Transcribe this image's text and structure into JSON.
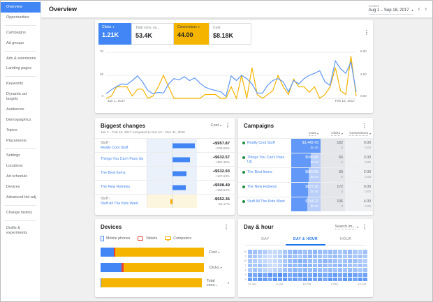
{
  "icons": {
    "kebab": "⋮",
    "caret": "▾",
    "chev_left": "‹",
    "chev_right": "›"
  },
  "colors": {
    "blue": "#4285f4",
    "yellow": "#f4b400",
    "red": "#ea4335",
    "green": "#1e8e3e",
    "heatmap_rgb": "66,133,244"
  },
  "sidebar": {
    "items": [
      {
        "label": "Overview",
        "selected": true
      },
      {
        "label": "Opportunities"
      },
      {
        "label": "Campaigns"
      },
      {
        "label": "Ad groups"
      },
      {
        "label": "Ads & extensions"
      },
      {
        "label": "Landing pages"
      },
      {
        "label": "Keywords"
      },
      {
        "label": "Dynamic ad targets"
      },
      {
        "label": "Audiences"
      },
      {
        "label": "Demographics"
      },
      {
        "label": "Topics"
      },
      {
        "label": "Placements"
      },
      {
        "label": "Settings"
      },
      {
        "label": "Locations"
      },
      {
        "label": "Ad schedule"
      },
      {
        "label": "Devices"
      },
      {
        "label": "Advanced bid adj."
      },
      {
        "label": "Change history"
      },
      {
        "label": "Drafts & experiments"
      }
    ]
  },
  "header": {
    "title": "Overview",
    "date_label": "Custom",
    "date_range": "Aug 1 – Sep 18, 2017"
  },
  "metrics": {
    "cards": [
      {
        "label": "Clicks",
        "value": "1.21K",
        "selected": true
      },
      {
        "label": "Total conv. va...",
        "value": "53.4K"
      },
      {
        "label": "Conversions",
        "value": "44.00",
        "selected": true
      },
      {
        "label": "Cost",
        "value": "$8.18K"
      }
    ]
  },
  "overview_chart": {
    "y_left": [
      "70",
      "35",
      "0"
    ],
    "y_right": [
      "6.00",
      "3.00",
      "0.00"
    ],
    "x_start": "Jan 1, 2017",
    "x_end": "Feb 18, 2017"
  },
  "biggest_changes": {
    "title": "Biggest changes",
    "subtitle": "Jan 1 – Feb 18, 2017 compared to Nov 13 – Dec 31, 2016",
    "metric_selector": "Cost",
    "rows": [
      {
        "prefix": "Stuff -",
        "name": "Really Cool Stuff",
        "change": "+$957.87",
        "percent": "+235.59%"
      },
      {
        "prefix": "",
        "name": "Things You Can't Pass Up",
        "change": "+$632.57",
        "percent": "+391.32%"
      },
      {
        "prefix": "",
        "name": "The Best Items",
        "change": "+$532.93",
        "percent": "+167.63%"
      },
      {
        "prefix": "",
        "name": "The New Hotness",
        "change": "+$508.49",
        "percent": "+159.52%"
      },
      {
        "prefix": "Stuff -",
        "name": "Stuff All The Kids Want",
        "change": "-$552.36",
        "percent": "-61.17%"
      }
    ]
  },
  "campaigns": {
    "title": "Campaigns",
    "columns": {
      "cost": "Cost",
      "clicks": "Clicks",
      "conversions": "Conversions"
    },
    "rows": [
      {
        "name": "Really Cool Stuff",
        "cost": "$1,442.43",
        "cost_sub": "$0.00",
        "clicks": "162",
        "clicks_sub": "0",
        "conv": "0.00",
        "conv_sub": "0.00"
      },
      {
        "name": "Things You Can't Pass Up",
        "cost": "$949.85",
        "cost_sub": "$0.00",
        "clicks": "66",
        "clicks_sub": "0",
        "conv": "3.00",
        "conv_sub": "0.00"
      },
      {
        "name": "The Best Items",
        "cost": "$850.85",
        "cost_sub": "$0.00",
        "clicks": "69",
        "clicks_sub": "0",
        "conv": "2.00",
        "conv_sub": "0.00"
      },
      {
        "name": "The New Hotness",
        "cost": "$827.26",
        "cost_sub": "$0.00",
        "clicks": "172",
        "clicks_sub": "0",
        "conv": "9.00",
        "conv_sub": "0.00"
      },
      {
        "name": "Stuff All The Kids Want",
        "cost": "$794.22",
        "cost_sub": "$0.00",
        "clicks": "106",
        "clicks_sub": "0",
        "conv": "4.00",
        "conv_sub": "0.00"
      }
    ]
  },
  "devices": {
    "title": "Devices",
    "legend": [
      {
        "label": "Mobile phones"
      },
      {
        "label": "Tablets"
      },
      {
        "label": "Computers"
      }
    ],
    "bars": [
      {
        "label": "Cost"
      },
      {
        "label": "Clicks"
      },
      {
        "label": "Total conv..."
      }
    ]
  },
  "day_hour": {
    "title": "Day & hour",
    "selector": "Search im...",
    "tabs": [
      "DAY",
      "DAY & HOUR",
      "HOUR"
    ],
    "active_tab": "DAY & HOUR",
    "day_labels": [
      "M",
      "T",
      "W",
      "T",
      "F",
      "S",
      "S"
    ],
    "hour_labels": [
      "12 AM",
      "6 AM",
      "12 PM",
      "6 PM",
      "12 AM"
    ]
  },
  "chart_data": [
    {
      "id": "overview_timeseries",
      "type": "line",
      "x_range": [
        "Jan 1, 2017",
        "Feb 18, 2017"
      ],
      "y_left_axis": {
        "label": "Clicks",
        "range": [
          0,
          70
        ],
        "ticks": [
          0,
          35,
          70
        ]
      },
      "y_right_axis": {
        "label": "Conversions",
        "range": [
          0,
          6
        ],
        "ticks": [
          0,
          3,
          6
        ]
      },
      "grid": true,
      "series": [
        {
          "name": "Clicks",
          "axis": "left",
          "color": "#5e97f6",
          "values": [
            7,
            13,
            18,
            22,
            21,
            27,
            34,
            25,
            12,
            7,
            9,
            8,
            22,
            30,
            28,
            33,
            27,
            31,
            23,
            17,
            14,
            12,
            10,
            3,
            34,
            27,
            35,
            30,
            22,
            8,
            8,
            20,
            27,
            30,
            25,
            10,
            27,
            22,
            30,
            35,
            38,
            42,
            25,
            20,
            57,
            45,
            38,
            55,
            10
          ]
        },
        {
          "name": "Conversions",
          "axis": "right",
          "color": "#f4b400",
          "values": [
            0,
            0.3,
            1.5,
            1.5,
            1.5,
            0.3,
            1.2,
            1.2,
            0,
            0.3,
            1.5,
            3.0,
            1.5,
            0,
            0,
            0,
            0,
            0,
            0,
            0.5,
            0.5,
            0.5,
            0,
            0,
            1.5,
            0,
            3.0,
            0,
            4.0,
            0.5,
            0,
            0.5,
            1.0,
            3.0,
            1.5,
            0.5,
            2.5,
            1.5,
            1.5,
            0.8,
            1.5,
            0,
            0.5,
            1.5,
            4.0,
            1.0,
            0.5,
            5.5,
            0.3
          ]
        }
      ]
    },
    {
      "id": "biggest_changes",
      "type": "bar",
      "metric": "Cost",
      "categories": [
        "Stuff - Really Cool Stuff",
        "Things You Can't Pass Up",
        "The Best Items",
        "The New Hotness",
        "Stuff - Stuff All The Kids Want"
      ],
      "values": [
        957.87,
        632.57,
        532.93,
        508.49,
        -552.36
      ],
      "percent_change": [
        235.59,
        391.32,
        167.63,
        159.52,
        -61.17
      ],
      "bar_fractions": [
        1.0,
        0.78,
        0.64,
        0.6,
        -0.07
      ]
    },
    {
      "id": "campaigns_table",
      "type": "table",
      "columns": [
        "Campaign",
        "Cost",
        "Clicks",
        "Conversions"
      ],
      "rows": [
        [
          "Really Cool Stuff",
          1442.43,
          162,
          0.0
        ],
        [
          "Things You Can't Pass Up",
          949.85,
          66,
          3.0
        ],
        [
          "The Best Items",
          850.85,
          69,
          2.0
        ],
        [
          "The New Hotness",
          827.26,
          172,
          9.0
        ],
        [
          "Stuff All The Kids Want",
          794.22,
          106,
          4.0
        ]
      ],
      "compare_values": {
        "cost": 0.0,
        "clicks": 0,
        "conversions": 0.0
      },
      "cost_bar_fractions": [
        1.0,
        0.66,
        0.59,
        0.57,
        0.55
      ]
    },
    {
      "id": "devices",
      "type": "bar",
      "stacked": true,
      "categories": [
        "Cost",
        "Clicks",
        "Total conv. value"
      ],
      "series": [
        {
          "name": "Mobile phones",
          "color": "#4285f4",
          "fractions": [
            0.13,
            0.2,
            0.01
          ]
        },
        {
          "name": "Tablets",
          "color": "#ea4335",
          "fractions": [
            0.015,
            0.02,
            0.0
          ]
        },
        {
          "name": "Computers",
          "color": "#f4b400",
          "fractions": [
            0.855,
            0.78,
            0.99
          ]
        }
      ]
    },
    {
      "id": "day_hour_heatmap",
      "type": "heatmap",
      "metric": "Search impressions",
      "rows": [
        "M",
        "T",
        "W",
        "T",
        "F",
        "S",
        "S"
      ],
      "x_ticks": [
        "12 AM",
        "6 AM",
        "12 PM",
        "6 PM",
        "12 AM"
      ],
      "color": "#4285f4",
      "values": [
        [
          0.55,
          0.5,
          0.45,
          0.4,
          0.3,
          0.3,
          0.35,
          0.45,
          0.55,
          0.6,
          0.55,
          0.5,
          0.55,
          0.6,
          0.55,
          0.5,
          0.55,
          0.5,
          0.45,
          0.5,
          0.55,
          0.45,
          0.4,
          0.5
        ],
        [
          0.5,
          0.45,
          0.4,
          0.3,
          0.25,
          0.3,
          0.4,
          0.5,
          0.55,
          0.5,
          0.45,
          0.55,
          0.6,
          0.55,
          0.5,
          0.45,
          0.5,
          0.55,
          0.5,
          0.45,
          0.5,
          0.45,
          0.5,
          0.45
        ],
        [
          0.45,
          0.4,
          0.35,
          0.3,
          0.25,
          0.3,
          0.35,
          0.45,
          0.55,
          0.6,
          0.65,
          0.6,
          0.55,
          0.5,
          0.55,
          0.6,
          0.55,
          0.5,
          0.45,
          0.5,
          0.55,
          0.5,
          0.45,
          0.4
        ],
        [
          0.5,
          0.45,
          0.5,
          0.4,
          0.3,
          0.25,
          0.35,
          0.5,
          0.6,
          0.55,
          0.6,
          0.65,
          0.6,
          0.55,
          0.6,
          0.55,
          0.5,
          0.55,
          0.6,
          0.55,
          0.5,
          0.45,
          0.5,
          0.45
        ],
        [
          0.45,
          0.5,
          0.45,
          0.35,
          0.3,
          0.35,
          0.4,
          0.5,
          0.55,
          0.6,
          0.55,
          0.6,
          0.55,
          0.6,
          0.55,
          0.5,
          0.55,
          0.5,
          0.55,
          0.5,
          0.55,
          0.5,
          0.45,
          0.5
        ],
        [
          0.75,
          0.7,
          0.8,
          0.7,
          0.85,
          0.75,
          0.9,
          0.8,
          0.7,
          0.75,
          0.8,
          0.75,
          0.7,
          0.8,
          0.75,
          0.7,
          0.75,
          0.8,
          0.7,
          0.75,
          0.8,
          0.75,
          0.7,
          0.75
        ],
        [
          0.8,
          0.75,
          0.85,
          0.8,
          0.7,
          0.9,
          0.8,
          0.85,
          0.75,
          0.8,
          0.7,
          0.85,
          0.8,
          0.75,
          0.8,
          0.7,
          0.85,
          0.8,
          0.75,
          0.85,
          0.8,
          0.75,
          0.85,
          0.8
        ]
      ]
    }
  ]
}
